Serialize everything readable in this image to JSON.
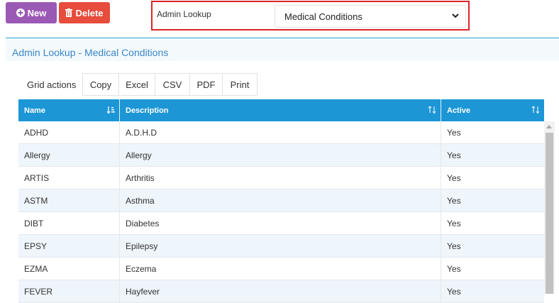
{
  "toolbar": {
    "new_label": "New",
    "delete_label": "Delete"
  },
  "lookup": {
    "label": "Admin Lookup",
    "selected": "Medical Conditions"
  },
  "panel": {
    "title": "Admin Lookup - Medical Conditions"
  },
  "grid_actions": {
    "label": "Grid actions",
    "buttons": [
      "Copy",
      "Excel",
      "CSV",
      "PDF",
      "Print"
    ]
  },
  "table": {
    "columns": [
      "Name",
      "Description",
      "Active"
    ],
    "rows": [
      {
        "name": "ADHD",
        "description": "A.D.H.D",
        "active": "Yes"
      },
      {
        "name": "Allergy",
        "description": "Allergy",
        "active": "Yes"
      },
      {
        "name": "ARTIS",
        "description": "Arthritis",
        "active": "Yes"
      },
      {
        "name": "ASTM",
        "description": "Asthma",
        "active": "Yes"
      },
      {
        "name": "DIBT",
        "description": "Diabetes",
        "active": "Yes"
      },
      {
        "name": "EPSY",
        "description": "Epilepsy",
        "active": "Yes"
      },
      {
        "name": "EZMA",
        "description": "Eczema",
        "active": "Yes"
      },
      {
        "name": "FEVER",
        "description": "Hayfever",
        "active": "Yes"
      }
    ]
  },
  "colors": {
    "new_button": "#9b59b6",
    "delete_button": "#e74c3c",
    "highlight_border": "#d9262b",
    "header_blue": "#1c96d5",
    "title_blue": "#3a87c8"
  },
  "icons": {
    "new": "plus-circle-icon",
    "delete": "trash-icon",
    "select": "chevron-down-icon",
    "sort_active": "sort-alpha-icon",
    "sort_inactive": "sort-icon"
  }
}
